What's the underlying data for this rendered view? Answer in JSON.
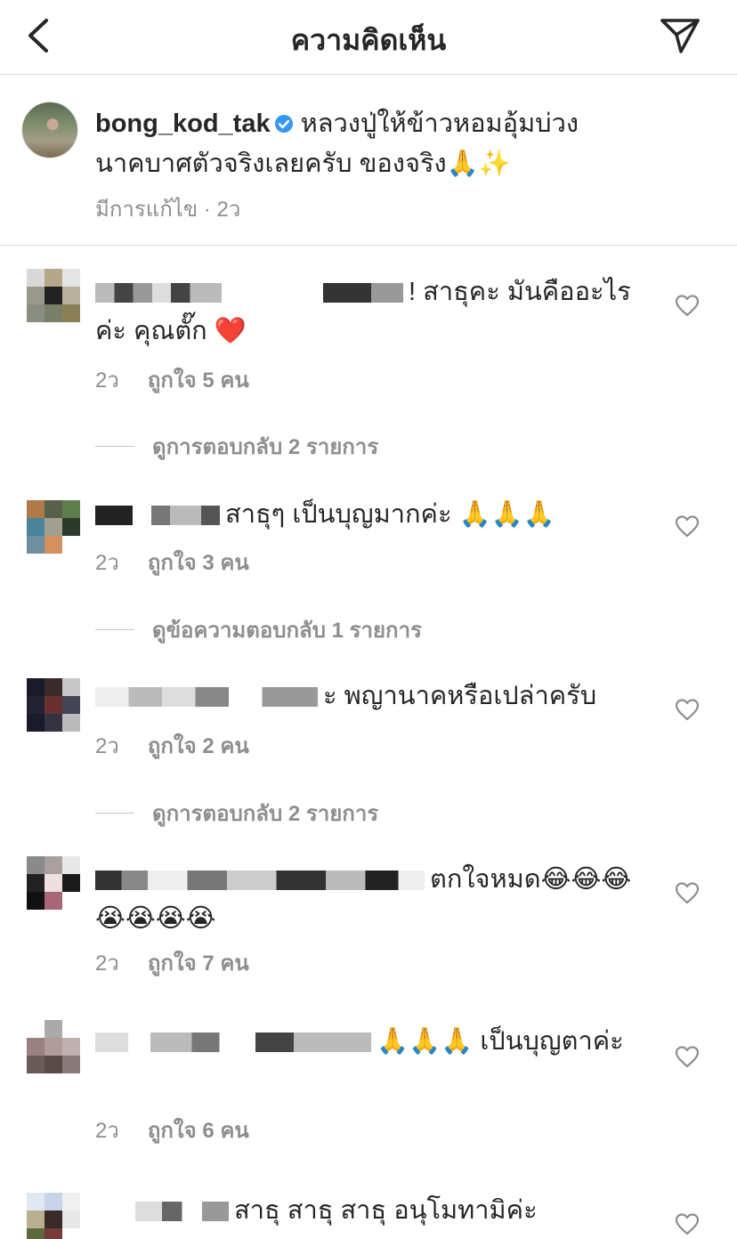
{
  "header": {
    "title": "ความคิดเห็น"
  },
  "caption": {
    "username": "bong_kod_tak",
    "text": "หลวงปู่ให้ข้าวหอมอุ้มบ่วงนาคบาศตัวจริงเลยครับ ของจริง🙏✨",
    "edited": "มีการแก้ไข",
    "time": "2ว"
  },
  "comments": [
    {
      "text": "! สาธุคะ มันคืออะไรค่ะ คุณตั๊ก ❤️",
      "time": "2ว",
      "likes": "ถูกใจ 5 คน",
      "replies": "ดูการตอบกลับ 2 รายการ"
    },
    {
      "text": "สาธุๆ เป็นบุญมากค่ะ 🙏🙏🙏",
      "time": "2ว",
      "likes": "ถูกใจ 3 คน",
      "replies": "ดูข้อความตอบกลับ 1 รายการ"
    },
    {
      "text": "ะ พญานาคหรือเปล่าครับ",
      "time": "2ว",
      "likes": "ถูกใจ 2 คน",
      "replies": "ดูการตอบกลับ 2 รายการ"
    },
    {
      "text": "ตกใจหมด😂😂😂😭😭😭😭",
      "time": "2ว",
      "likes": "ถูกใจ 7 คน"
    },
    {
      "text": "🙏🙏🙏 เป็นบุญตาค่ะ",
      "time": "2ว",
      "likes": "ถูกใจ 6 คน"
    },
    {
      "text": "สาธุ  สาธุ สาธุ อนุโมทามิค่ะ"
    }
  ],
  "icons": {
    "back": "chevron-left-icon",
    "send": "paper-plane-icon",
    "verified": "verified-badge-icon",
    "like": "heart-outline-icon"
  },
  "colors": {
    "verified": "#3897f0",
    "meta": "#8e8e8e",
    "text": "#262626",
    "divider": "#dbdbdb"
  }
}
